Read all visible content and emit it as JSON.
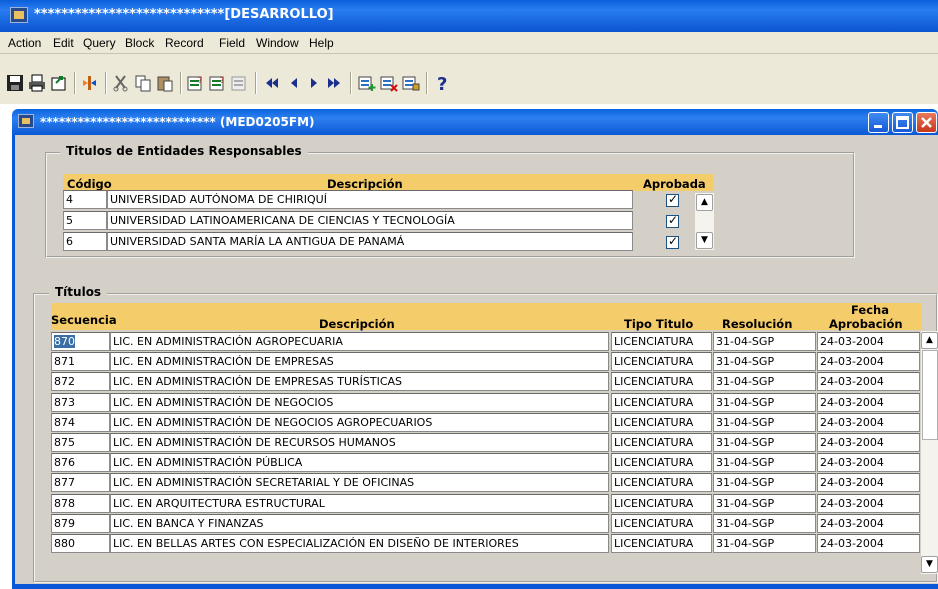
{
  "app_title": "****************************[DESARROLLO]",
  "menu": [
    "Action",
    "Edit",
    "Query",
    "Block",
    "Record",
    "Field",
    "Window",
    "Help"
  ],
  "toolbar_icons": [
    "save-icon",
    "print-icon",
    "exit-form-icon",
    "enter-query-icon",
    "cut-icon",
    "copy-icon",
    "paste-icon",
    "insert-record-icon",
    "duplicate-record-icon",
    "clear-record-icon",
    "first-record-icon",
    "previous-record-icon",
    "next-record-icon",
    "last-record-icon",
    "add-row-icon",
    "delete-row-icon",
    "lock-record-icon",
    "help-icon"
  ],
  "form_title": "****************************  (MED0205FM)",
  "entidades": {
    "title": "Titulos de Entidades Responsables",
    "headers": {
      "codigo": "Código",
      "descripcion": "Descripción",
      "aprobada": "Aprobada"
    },
    "rows": [
      {
        "codigo": "4",
        "descripcion": "UNIVERSIDAD AUTÓNOMA DE CHIRIQUÍ",
        "aprobada": true
      },
      {
        "codigo": "5",
        "descripcion": "UNIVERSIDAD LATINOAMERICANA DE CIENCIAS Y TECNOLOGÍA",
        "aprobada": true
      },
      {
        "codigo": "6",
        "descripcion": "UNIVERSIDAD SANTA MARÍA LA ANTIGUA DE PANAMÁ",
        "aprobada": true
      }
    ]
  },
  "titulos": {
    "title": "Títulos",
    "headers": {
      "secuencia": "Secuencia",
      "descripcion": "Descripción",
      "tipo": "Tipo Titulo",
      "resolucion": "Resolución",
      "fecha_line1": "Fecha",
      "fecha_line2": "Aprobación"
    },
    "rows": [
      {
        "secuencia": "870",
        "descripcion": "LIC. EN ADMINISTRACIÓN AGROPECUARIA",
        "tipo": "LICENCIATURA",
        "resolucion": "31-04-SGP",
        "fecha": "24-03-2004"
      },
      {
        "secuencia": "871",
        "descripcion": "LIC. EN ADMINISTRACIÓN DE EMPRESAS",
        "tipo": "LICENCIATURA",
        "resolucion": "31-04-SGP",
        "fecha": "24-03-2004"
      },
      {
        "secuencia": "872",
        "descripcion": "LIC. EN ADMINISTRACIÓN DE EMPRESAS TURÍSTICAS",
        "tipo": "LICENCIATURA",
        "resolucion": "31-04-SGP",
        "fecha": "24-03-2004"
      },
      {
        "secuencia": "873",
        "descripcion": "LIC. EN ADMINISTRACIÓN DE NEGOCIOS",
        "tipo": "LICENCIATURA",
        "resolucion": "31-04-SGP",
        "fecha": "24-03-2004"
      },
      {
        "secuencia": "874",
        "descripcion": "LIC. EN ADMINISTRACIÓN DE NEGOCIOS AGROPECUARIOS",
        "tipo": "LICENCIATURA",
        "resolucion": "31-04-SGP",
        "fecha": "24-03-2004"
      },
      {
        "secuencia": "875",
        "descripcion": "LIC. EN ADMINISTRACIÓN DE RECURSOS HUMANOS",
        "tipo": "LICENCIATURA",
        "resolucion": "31-04-SGP",
        "fecha": "24-03-2004"
      },
      {
        "secuencia": "876",
        "descripcion": "LIC. EN ADMINISTRACIÓN PÚBLICA",
        "tipo": "LICENCIATURA",
        "resolucion": "31-04-SGP",
        "fecha": "24-03-2004"
      },
      {
        "secuencia": "877",
        "descripcion": "LIC. EN ADMINISTRACIÓN SECRETARIAL Y DE OFICINAS",
        "tipo": "LICENCIATURA",
        "resolucion": "31-04-SGP",
        "fecha": "24-03-2004"
      },
      {
        "secuencia": "878",
        "descripcion": "LIC. EN ARQUITECTURA ESTRUCTURAL",
        "tipo": "LICENCIATURA",
        "resolucion": "31-04-SGP",
        "fecha": "24-03-2004"
      },
      {
        "secuencia": "879",
        "descripcion": "LIC. EN BANCA Y FINANZAS",
        "tipo": "LICENCIATURA",
        "resolucion": "31-04-SGP",
        "fecha": "24-03-2004"
      },
      {
        "secuencia": "880",
        "descripcion": "LIC. EN BELLAS ARTES CON ESPECIALIZACIÓN EN DISEÑO DE INTERIORES",
        "tipo": "LICENCIATURA",
        "resolucion": "31-04-SGP",
        "fecha": "24-03-2004"
      }
    ]
  },
  "colors": {
    "header_bg": "#f5cc6a",
    "titlebar": "#0a58d6",
    "selection": "#3a6ea5"
  }
}
